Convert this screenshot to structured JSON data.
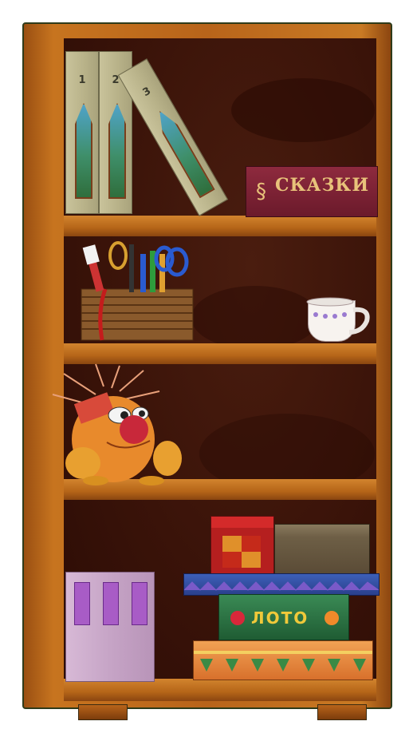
{
  "scene": {
    "binders": [
      {
        "number": "1"
      },
      {
        "number": "2"
      },
      {
        "number": "3"
      }
    ],
    "fairy_tales_book": {
      "title": "СКАЗКИ"
    },
    "lotto_box": {
      "label": "ЛОТО"
    },
    "colors": {
      "wood": "#b8641a",
      "back_panel": "#3a1309",
      "binder": "#c9c39b",
      "book_red": "#8e2a3e",
      "lotto_green": "#2f7a45",
      "lotto_text": "#f0c93a"
    },
    "icons": [
      "pencil-cup-icon",
      "teacup-icon",
      "kuzya-toy-icon",
      "red-box-icon",
      "gray-box-icon",
      "purple-binders-icon"
    ]
  }
}
